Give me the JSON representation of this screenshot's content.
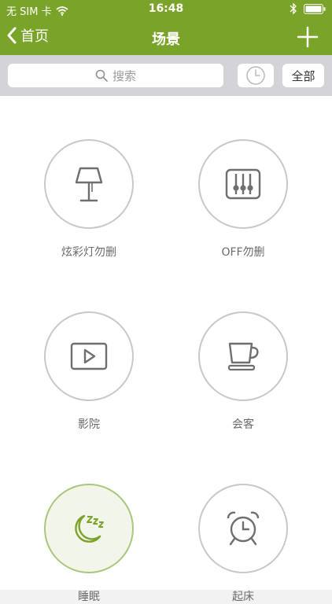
{
  "status_bar": {
    "carrier": "无 SIM 卡",
    "time": "16:48"
  },
  "nav": {
    "back_label": "首页",
    "title": "场景"
  },
  "search": {
    "placeholder": "搜索"
  },
  "filter": {
    "all_label": "全部"
  },
  "scenes": [
    {
      "label": "炫彩灯勿删",
      "icon": "lamp-icon"
    },
    {
      "label": "OFF勿删",
      "icon": "sliders-icon"
    },
    {
      "label": "影院",
      "icon": "play-icon"
    },
    {
      "label": "会客",
      "icon": "cup-icon"
    },
    {
      "label": "睡眠",
      "icon": "moon-sleep-icon",
      "active": true
    },
    {
      "label": "起床",
      "icon": "alarm-clock-icon"
    }
  ],
  "colors": {
    "brand": "#7aa429",
    "active_icon": "#7aa429",
    "icon": "#6f6f6f"
  }
}
